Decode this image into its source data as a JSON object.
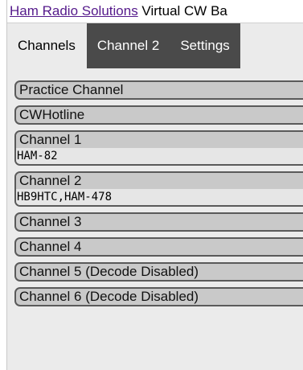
{
  "header": {
    "link_text": "Ham Radio Solutions",
    "title_rest": " Virtual CW Ba"
  },
  "tabs": [
    {
      "label": "Channels",
      "active": true
    },
    {
      "label": "Channel 2",
      "active": false
    },
    {
      "label": "Settings",
      "active": false
    }
  ],
  "channels": [
    {
      "name": "Practice Channel",
      "users": ""
    },
    {
      "name": "CWHotline",
      "users": ""
    },
    {
      "name": "Channel 1",
      "users": "HAM-82"
    },
    {
      "name": "Channel 2",
      "users": "HB9HTC,HAM-478"
    },
    {
      "name": "Channel 3",
      "users": ""
    },
    {
      "name": "Channel 4",
      "users": ""
    },
    {
      "name": "Channel 5 (Decode Disabled)",
      "users": ""
    },
    {
      "name": "Channel 6 (Decode Disabled)",
      "users": ""
    }
  ],
  "colors": {
    "tab_dark": "#4a4a4a",
    "panel_bg": "#ebebeb",
    "channel_bg": "#c9c9c9",
    "channel_border": "#5a5a5a",
    "link": "#551a8b"
  }
}
